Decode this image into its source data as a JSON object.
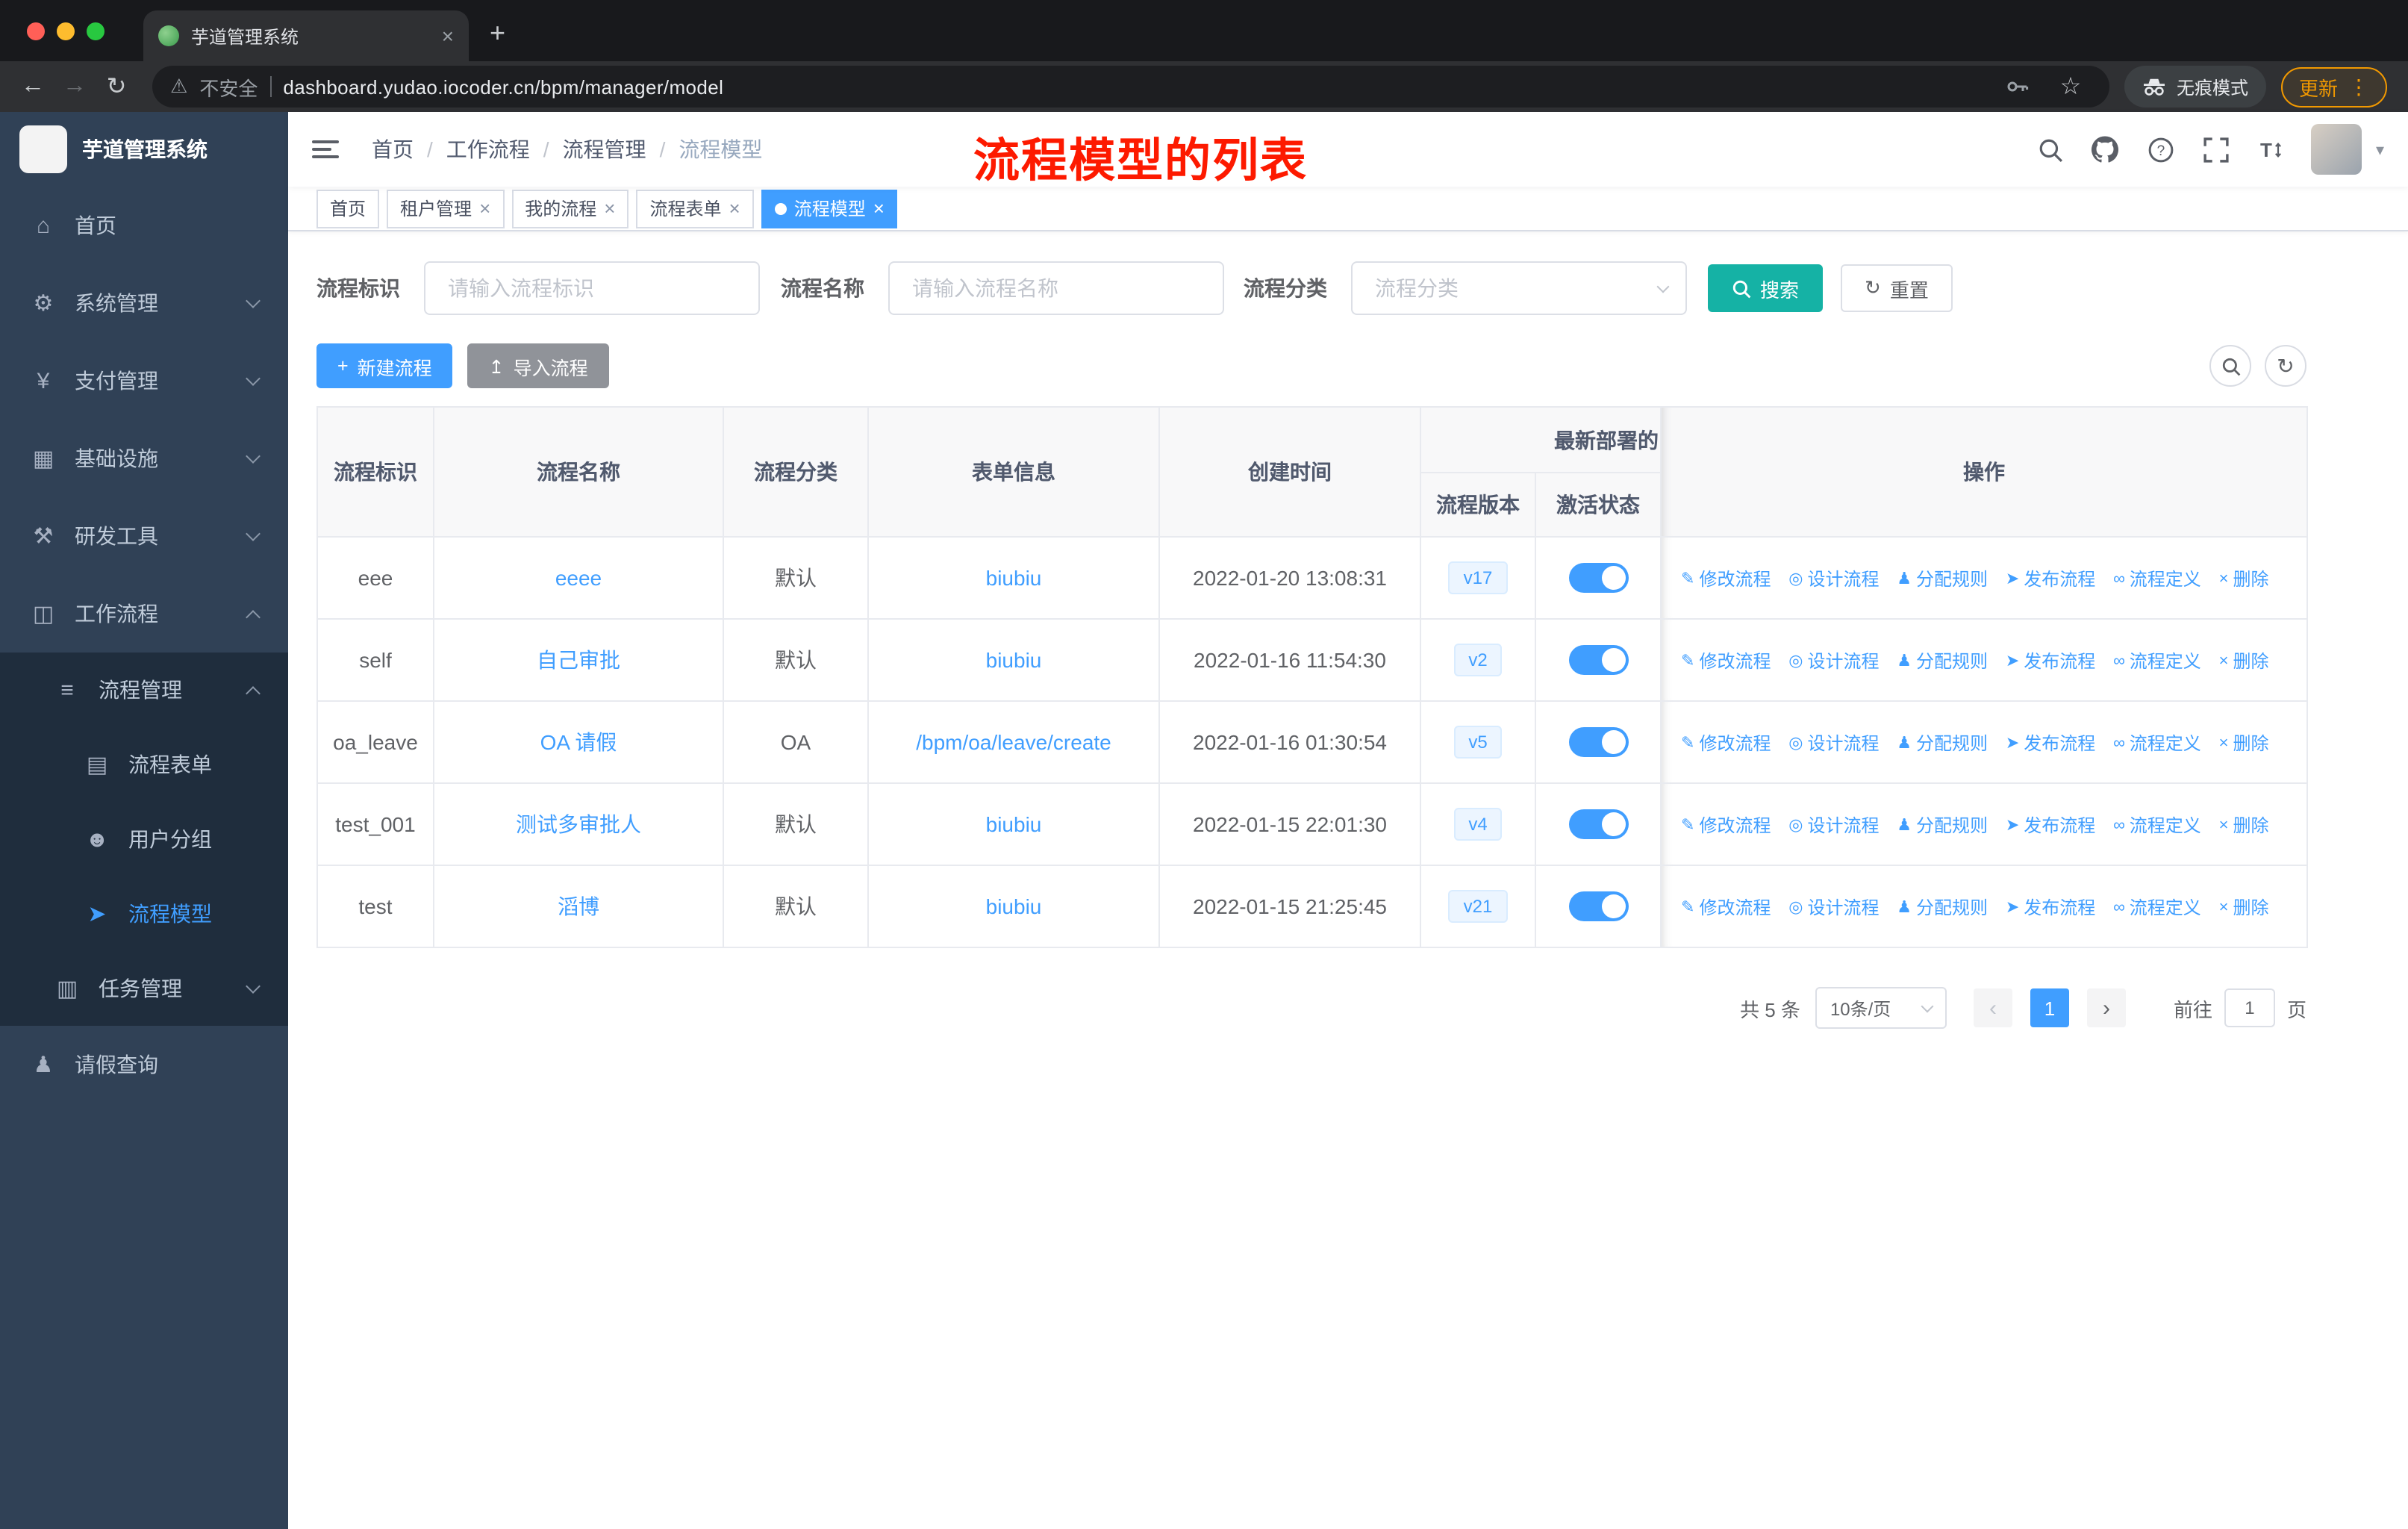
{
  "colors": {
    "accent": "#409eff",
    "search_button": "#15b2a5",
    "sidebar_bg": "#304156",
    "sidebar_submenu_bg": "#1f2d3d",
    "annotation_red": "#fd1a00",
    "update_pill_orange": "#f29900"
  },
  "annotation": "流程模型的列表",
  "browser": {
    "tab_title": "芋道管理系统",
    "security_label": "不安全",
    "url": "dashboard.yudao.iocoder.cn/bpm/manager/model",
    "incognito_label": "无痕模式",
    "update_label": "更新"
  },
  "icons": {
    "home": "⌂",
    "system": "⚙",
    "pay": "¥",
    "infra": "▦",
    "dev": "⚒",
    "work": "◫",
    "flow_mgmt": "≡",
    "flow_form": "▤",
    "user_group": "☻",
    "flow_model": "➤",
    "task_mgmt": "▥",
    "leave_query": "♟",
    "edit": "✎",
    "design": "◎",
    "assign": "♟",
    "publish": "➤",
    "definition": "∞",
    "delete": "×",
    "plus": "+",
    "upload": "↥",
    "refresh": "↻",
    "reload": "↻",
    "back": "←",
    "forward": "→",
    "warning": "⚠",
    "star": "☆",
    "dots": "⋮",
    "close": "×",
    "caret": "▾"
  },
  "sidebar": {
    "logo_title": "芋道管理系统",
    "menu": [
      {
        "label": "首页"
      },
      {
        "label": "系统管理"
      },
      {
        "label": "支付管理"
      },
      {
        "label": "基础设施"
      },
      {
        "label": "研发工具"
      },
      {
        "label": "工作流程"
      },
      {
        "label": "流程管理"
      },
      {
        "label": "流程表单"
      },
      {
        "label": "用户分组"
      },
      {
        "label": "流程模型"
      },
      {
        "label": "任务管理"
      },
      {
        "label": "请假查询"
      }
    ]
  },
  "breadcrumb": {
    "items": [
      "首页",
      "工作流程",
      "流程管理",
      "流程模型"
    ]
  },
  "tags": [
    {
      "label": "首页"
    },
    {
      "label": "租户管理"
    },
    {
      "label": "我的流程"
    },
    {
      "label": "流程表单"
    },
    {
      "label": "流程模型"
    }
  ],
  "filters": {
    "id_label": "流程标识",
    "id_placeholder": "请输入流程标识",
    "name_label": "流程名称",
    "name_placeholder": "请输入流程名称",
    "category_label": "流程分类",
    "category_placeholder": "流程分类",
    "search_label": "搜索",
    "reset_label": "重置"
  },
  "toolbar": {
    "create_label": "新建流程",
    "import_label": "导入流程"
  },
  "table": {
    "headers": {
      "id": "流程标识",
      "name": "流程名称",
      "category": "流程分类",
      "form": "表单信息",
      "created": "创建时间",
      "deploy_group": "最新部署的",
      "version": "流程版本",
      "active": "激活状态",
      "actions": "操作"
    },
    "ops": {
      "edit": "修改流程",
      "design": "设计流程",
      "assign": "分配规则",
      "publish": "发布流程",
      "definition": "流程定义",
      "delete": "删除"
    },
    "rows": [
      {
        "id": "eee",
        "name": "eeee",
        "category": "默认",
        "form": "biubiu",
        "created": "2022-01-20 13:08:31",
        "version": "v17",
        "active": true
      },
      {
        "id": "self",
        "name": "自己审批",
        "category": "默认",
        "form": "biubiu",
        "created": "2022-01-16 11:54:30",
        "version": "v2",
        "active": true
      },
      {
        "id": "oa_leave",
        "name": "OA 请假",
        "category": "OA",
        "form": "/bpm/oa/leave/create",
        "created": "2022-01-16 01:30:54",
        "version": "v5",
        "active": true
      },
      {
        "id": "test_001",
        "name": "测试多审批人",
        "category": "默认",
        "form": "biubiu",
        "created": "2022-01-15 22:01:30",
        "version": "v4",
        "active": true
      },
      {
        "id": "test",
        "name": "滔博",
        "category": "默认",
        "form": "biubiu",
        "created": "2022-01-15 21:25:45",
        "version": "v21",
        "active": true
      }
    ]
  },
  "pagination": {
    "total": "共 5 条",
    "page_size": "10条/页",
    "prev": "‹",
    "next": "›",
    "current_page": "1",
    "goto_label": "前往",
    "goto_value": "1",
    "page_unit": "页"
  }
}
